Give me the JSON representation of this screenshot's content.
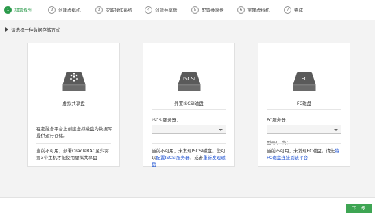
{
  "wizard": {
    "steps": [
      {
        "num": "1",
        "label": "部署规划"
      },
      {
        "num": "2",
        "label": "创建虚拟机"
      },
      {
        "num": "3",
        "label": "安装操作系统"
      },
      {
        "num": "4",
        "label": "创建共享盘"
      },
      {
        "num": "5",
        "label": "配置共享盘"
      },
      {
        "num": "6",
        "label": "克隆虚拟机"
      },
      {
        "num": "7",
        "label": "完成"
      }
    ],
    "active_step": 1
  },
  "main": {
    "section_title": "请选择一种数据存储方式"
  },
  "cards": {
    "virtual": {
      "icon_label": "",
      "title": "虚拟共享盘",
      "desc": "在超融合平台上创建虚拟磁盘为数据库提供运行存储。",
      "note": "当前不可用，部署OracleRAC至少需要3个主机才能使用虚拟共享盘"
    },
    "iscsi": {
      "icon_label": "ISCSI",
      "title": "外置ISCSI磁盘",
      "field_label": "ISCSI服务器：",
      "selected": "",
      "note_pre": "当前不可用，未发现ISCSI磁盘。您可以",
      "link1": "配置ISCSI服务器",
      "note_mid": "，或者",
      "link2": "重新发现磁盘"
    },
    "fc": {
      "icon_label": "FC",
      "title": "FC磁盘",
      "field_label": "FC服务器：",
      "selected": "",
      "vendor": "型号/厂商：-",
      "note_pre": "当前不可用，未发现FC磁盘。请先",
      "link1": "将FC磁盘连接到该平台"
    }
  },
  "footer": {
    "next_label": "下一步"
  },
  "colors": {
    "accent": "#2b9a4b",
    "button": "#3ea553",
    "link": "#1a4fd1",
    "icon_dark": "#555555"
  }
}
